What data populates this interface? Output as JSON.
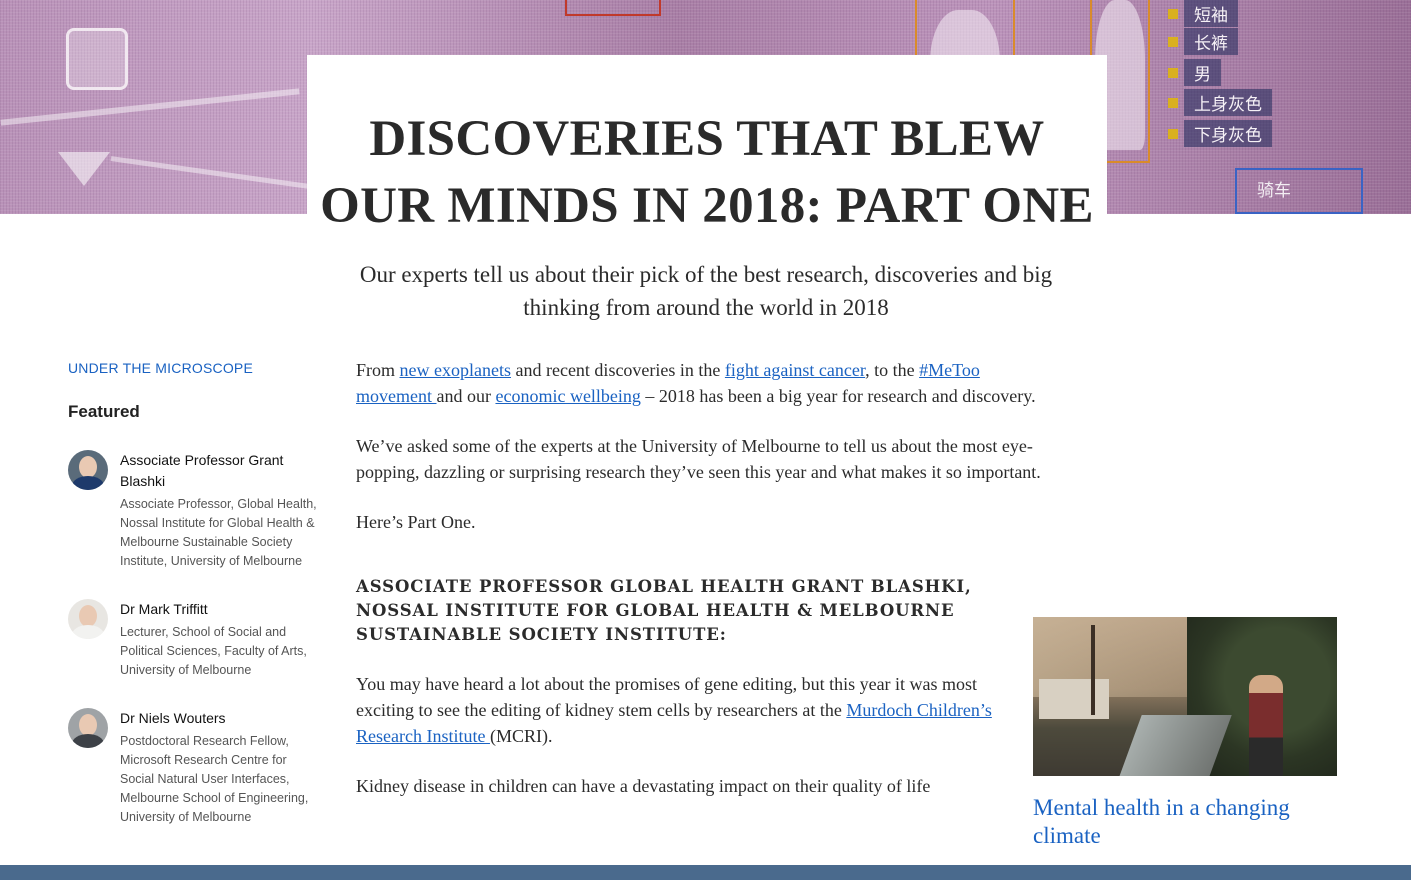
{
  "page": {
    "title": "DISCOVERIES THAT BLEW OUR MINDS IN 2018: PART ONE",
    "subtitle": "Our experts tell us about their pick of the best research, discoveries and big thinking from around the world in 2018"
  },
  "hero": {
    "tags": [
      "短袖",
      "长裤",
      "男",
      "上身灰色",
      "下身灰色"
    ],
    "box_label": "骑车"
  },
  "sidebar": {
    "section_link": "UNDER THE MICROSCOPE",
    "featured_heading": "Featured",
    "authors": [
      {
        "name": "Associate Professor Grant Blashki",
        "role": "Associate Professor, Global Health, Nossal Institute for Global Health & Melbourne Sustainable Society Institute, University of Melbourne"
      },
      {
        "name": "Dr Mark Triffitt",
        "role": "Lecturer, School of Social and Political Sciences, Faculty of Arts, University of Melbourne"
      },
      {
        "name": "Dr Niels Wouters",
        "role": "Postdoctoral Research Fellow, Microsoft Research Centre for Social Natural User Interfaces, Melbourne School of Engineering, University of Melbourne"
      }
    ]
  },
  "article": {
    "intro": {
      "t1": "From ",
      "link1": "new exoplanets",
      "t2": " and recent discoveries in the ",
      "link2": "fight against cancer",
      "t3": ", to the ",
      "link3": "#MeToo movement ",
      "t4": "and our ",
      "link4": "economic wellbeing",
      "t5": " – 2018 has been a big year for research and discovery."
    },
    "p2": "We’ve asked some of the experts at the University of Melbourne to tell us about the most eye-popping, dazzling or surprising research they’ve seen this year and what makes it so important.",
    "p3": "Here’s Part One.",
    "section_heading": "ASSOCIATE PROFESSOR GLOBAL HEALTH GRANT BLASHKI, NOSSAL INSTITUTE FOR GLOBAL HEALTH & MELBOURNE SUSTAINABLE SOCIETY INSTITUTE:",
    "p4": {
      "t1": "You may have heard a lot about the promises of gene editing, but this year it was most exciting to see the editing of kidney stem cells by researchers at the ",
      "link": "Murdoch Children’s Research Institute ",
      "t2": "(MCRI)."
    },
    "p5": "Kidney disease in children can have a devastating impact on their quality of life"
  },
  "related": {
    "title": "Mental health in a changing climate"
  },
  "colors": {
    "link": "#1a62c2",
    "hero_tint": "#b992b8",
    "bottom_bar": "#4a6a8d"
  }
}
